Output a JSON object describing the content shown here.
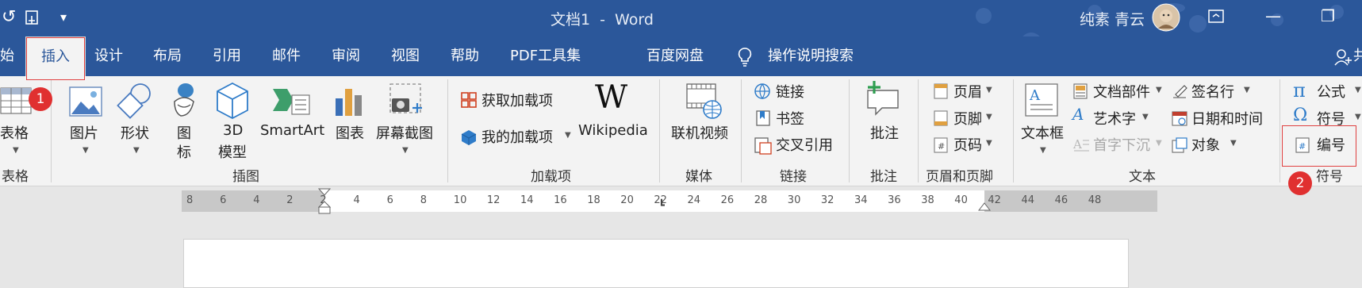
{
  "titlebar": {
    "doc_title": "文档1",
    "separator": "-",
    "app_name": "Word",
    "user_name": "纯素 青云",
    "qat_more": "▾",
    "ribbon_display_icon": "ribbon-display-options-icon",
    "minimize_glyph": "—",
    "restore_glyph": "❐"
  },
  "tabs": {
    "cut_prev": "始",
    "items": [
      "插入",
      "设计",
      "布局",
      "引用",
      "邮件",
      "审阅",
      "视图",
      "帮助",
      "PDF工具集",
      "百度网盘"
    ],
    "tell_me": "操作说明搜索",
    "share_cut": "共"
  },
  "ribbon": {
    "table": {
      "label": "表格",
      "group": "表格"
    },
    "illustrations": {
      "pictures": "图片",
      "shapes": "形状",
      "icons_line1": "图",
      "icons_line2": "标",
      "model_line1": "3D",
      "model_line2": "模型",
      "smartart": "SmartArt",
      "chart": "图表",
      "screenshot": "屏幕截图",
      "group": "插图"
    },
    "addins": {
      "get": "获取加载项",
      "mine": "我的加载项",
      "wikipedia": "Wikipedia",
      "wiki_logo": "W",
      "group": "加载项"
    },
    "media": {
      "online_video": "联机视频",
      "group": "媒体"
    },
    "links": {
      "link": "链接",
      "bookmark": "书签",
      "cross_ref": "交叉引用",
      "group": "链接"
    },
    "comments": {
      "comment": "批注",
      "group": "批注"
    },
    "header_footer": {
      "header": "页眉",
      "footer": "页脚",
      "page_number": "页码",
      "group": "页眉和页脚"
    },
    "text": {
      "textbox": "文本框",
      "quick_parts": "文档部件",
      "wordart": "艺术字",
      "drop_cap": "首字下沉",
      "signature": "签名行",
      "datetime": "日期和时间",
      "object": "对象",
      "group": "文本"
    },
    "symbols": {
      "equation": "公式",
      "symbol": "符号",
      "number": "编号",
      "group": "符号"
    }
  },
  "annotations": {
    "badge1": "1",
    "badge2": "2"
  },
  "ruler": {
    "labels": [
      "8",
      "6",
      "4",
      "2",
      "2",
      "4",
      "6",
      "8",
      "10",
      "12",
      "14",
      "16",
      "18",
      "20",
      "22",
      "24",
      "26",
      "28",
      "30",
      "32",
      "34",
      "36",
      "38",
      "40",
      "42",
      "44",
      "46",
      "48"
    ]
  },
  "colors": {
    "word_blue": "#2b579a",
    "ribbon_bg": "#f3f3f3",
    "annotation_red": "#e03030"
  }
}
